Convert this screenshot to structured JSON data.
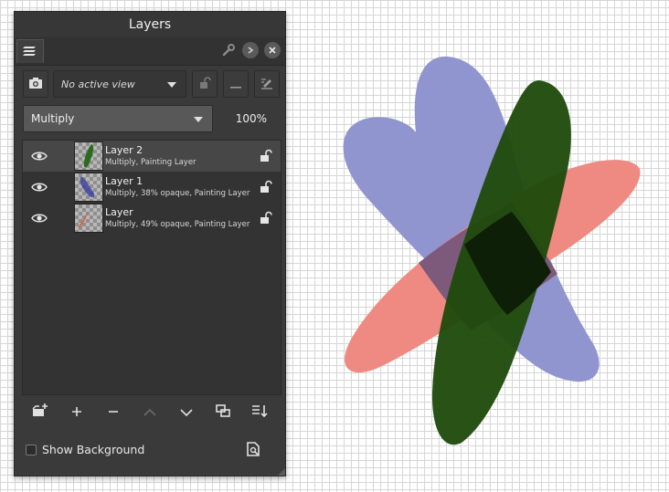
{
  "panel": {
    "title": "Layers",
    "active_view_placeholder": "No active view",
    "blend_mode": "Multiply",
    "opacity": "100%",
    "show_background_label": "Show Background",
    "show_background_checked": false
  },
  "layers": [
    {
      "name": "Layer 2",
      "description": "Multiply, Painting Layer",
      "selected": true,
      "thumb_color": "#2d6a1e"
    },
    {
      "name": "Layer 1",
      "description": "Multiply, 38% opaque, Painting Layer",
      "selected": false,
      "thumb_color": "#3b3fa0"
    },
    {
      "name": "Layer",
      "description": "Multiply, 49% opaque, Painting Layer",
      "selected": false,
      "thumb_color": "#d65a3c"
    }
  ],
  "icons": {
    "tab": "layers-stack-icon",
    "config": "wrench-icon",
    "float": "float-panel-icon",
    "close": "close-icon",
    "snapshot": "camera-icon",
    "lock": "lock-icon",
    "remove": "minus-icon",
    "edit": "edit-icon",
    "new_layer_menu": "new-layer-icon",
    "add": "plus-icon",
    "delete": "minus-icon",
    "move_up": "chevron-up-icon",
    "move_down": "chevron-down-icon",
    "duplicate": "duplicate-icon",
    "sort": "sort-icon",
    "thumbnail_page": "thumbnail-page-icon"
  },
  "colors": {
    "panel_bg": "#3a3a3a",
    "selected_row": "#474747",
    "shape_blue": "#9095cf",
    "shape_red": "#f08a82",
    "shape_green": "#1f4b0d"
  }
}
